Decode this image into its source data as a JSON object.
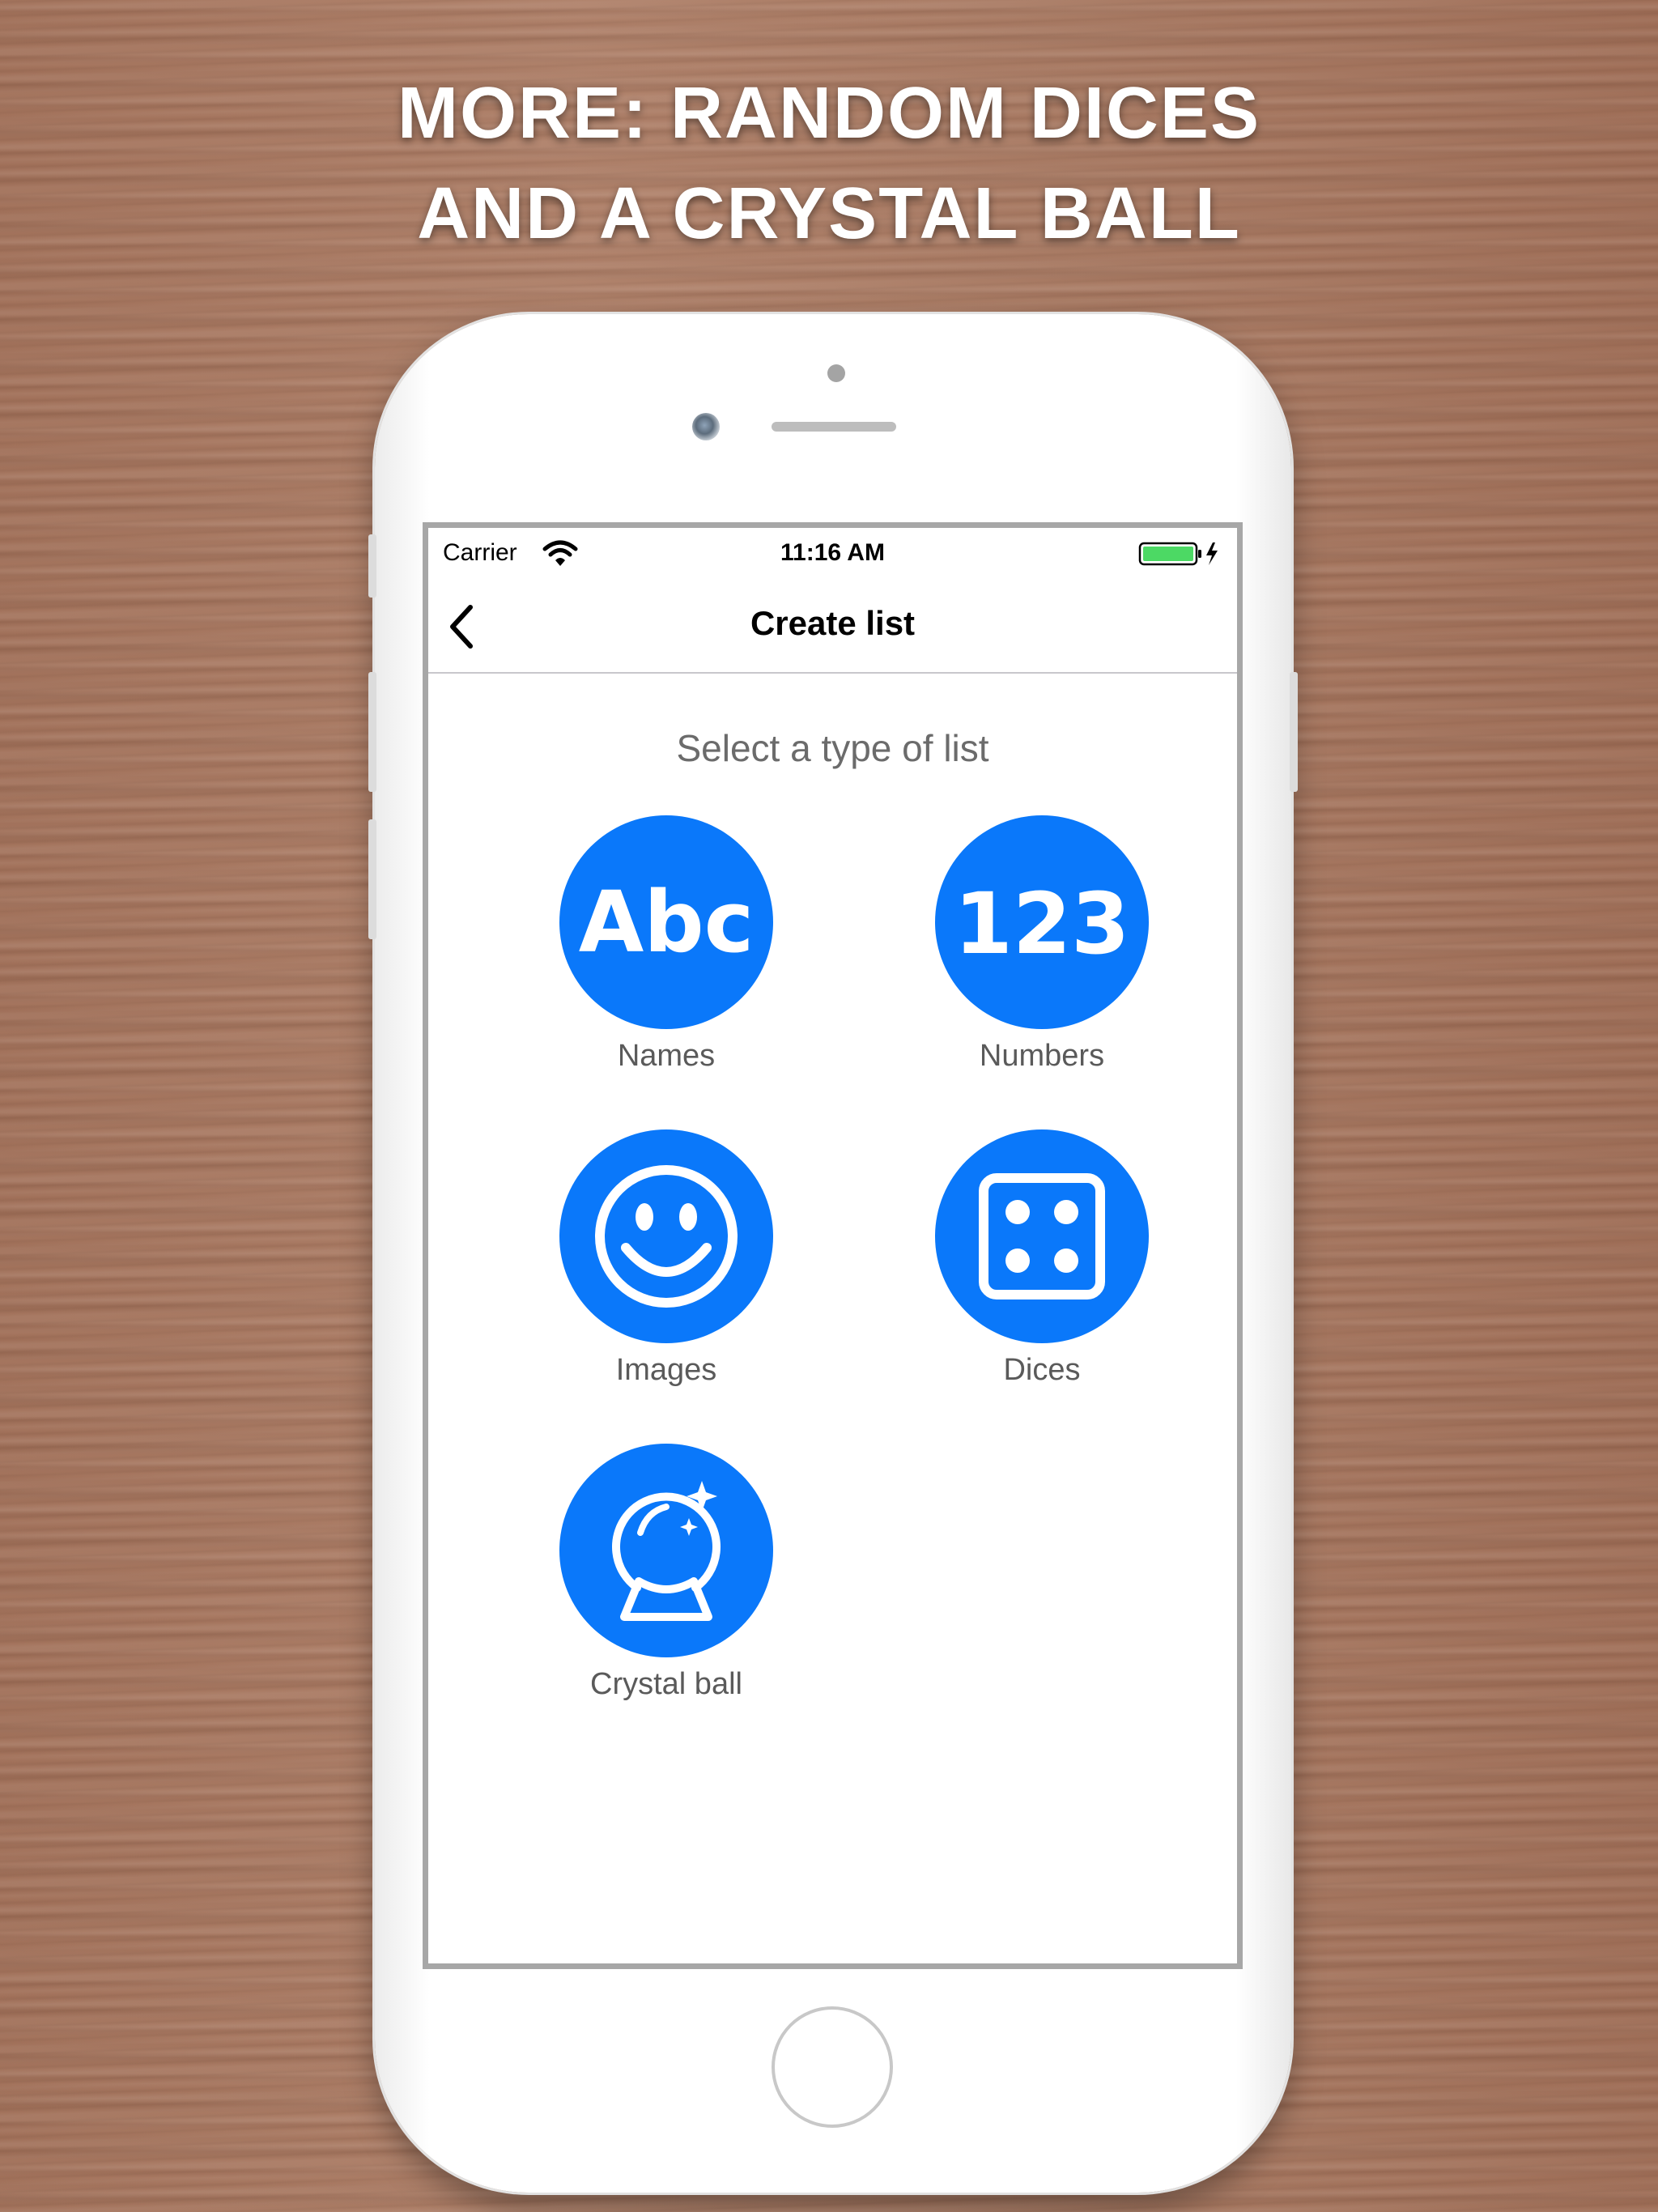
{
  "promo": {
    "line1": "MORE: RANDOM DICES",
    "line2": "AND A CRYSTAL BALL"
  },
  "status_bar": {
    "carrier": "Carrier",
    "time": "11:16 AM",
    "battery_color": "#4cd964"
  },
  "nav": {
    "back_icon": "chevron-left-icon",
    "title": "Create list"
  },
  "content": {
    "subtitle": "Select a type of list",
    "accent_color": "#0a78fa",
    "options": [
      {
        "label": "Names",
        "icon": "abc-icon",
        "icon_text": "Abc"
      },
      {
        "label": "Numbers",
        "icon": "123-icon",
        "icon_text": "123"
      },
      {
        "label": "Images",
        "icon": "smiley-icon"
      },
      {
        "label": "Dices",
        "icon": "dice-icon"
      },
      {
        "label": "Crystal ball",
        "icon": "crystal-ball-icon"
      }
    ]
  }
}
